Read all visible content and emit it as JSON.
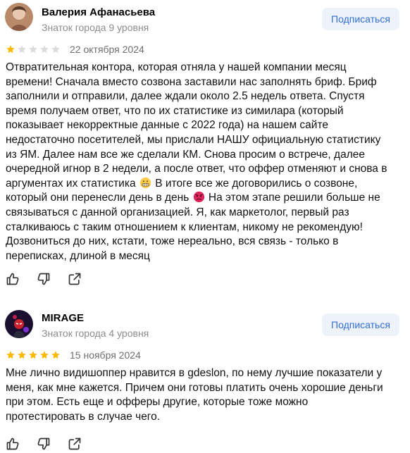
{
  "reviews": [
    {
      "author": "Валерия Афанасьева",
      "level": "Знаток города 9 уровня",
      "subscribe_label": "Подписаться",
      "rating": 1,
      "date": "22 октября 2024",
      "lines": [
        "Отвратительная контора, которая отняла у нашей компании месяц",
        "времени! Сначала вместо созвона заставили нас заполнять бриф. Бриф",
        "заполнили и отправили, далее ждали около 2.5 недель ответа. Спустя",
        "время получаем ответ, что по их статистике из симилара (который",
        "показывает некорректные данные с 2022 года) на нашем сайте",
        "недостаточно посетителей, мы прислали НАШУ официальную статистику",
        "из ЯМ. Далее нам все же сделали КМ. Снова просим о встрече, далее",
        "очередной игнор в 2 недели, а после ответ, что оффер отменяют и снова в",
        [
          "аргументах их статистика ",
          "grimace",
          " В итоге все же договорились о созвоне,"
        ],
        [
          "который они перенесли день в день ",
          "pouting",
          " На этом этапе решили больше не"
        ],
        "связываться с данной организацией. Я, как маркетолог, первый раз",
        "сталкиваюсь с таким отношением к клиентам, никому не рекомендую!",
        "Дозвониться до них, кстати, тоже нереально, вся связь - только в",
        "переписках, длиной в месяц"
      ]
    },
    {
      "author": "MIRAGE",
      "level": "Знаток города 4 уровня",
      "subscribe_label": "Подписаться",
      "rating": 5,
      "date": "15 ноября 2024",
      "lines": [
        "Мне лично видишоппер нравится в gdeslon, по нему лучшие показатели у",
        "меня, как мне кажется. Причем они готовы платить очень хорошие деньги",
        "при этом. Есть еще и офферы другие, которые тоже можно",
        "протестировать в случае чего."
      ]
    }
  ],
  "colors": {
    "star_filled": "#fcb900",
    "star_empty": "#dcdcdc",
    "subscribe_bg": "#eef2fa",
    "subscribe_text": "#3070d8"
  },
  "icons": [
    "like-icon",
    "dislike-icon",
    "share-icon",
    "grimace-emoji-icon",
    "pouting-emoji-icon"
  ]
}
